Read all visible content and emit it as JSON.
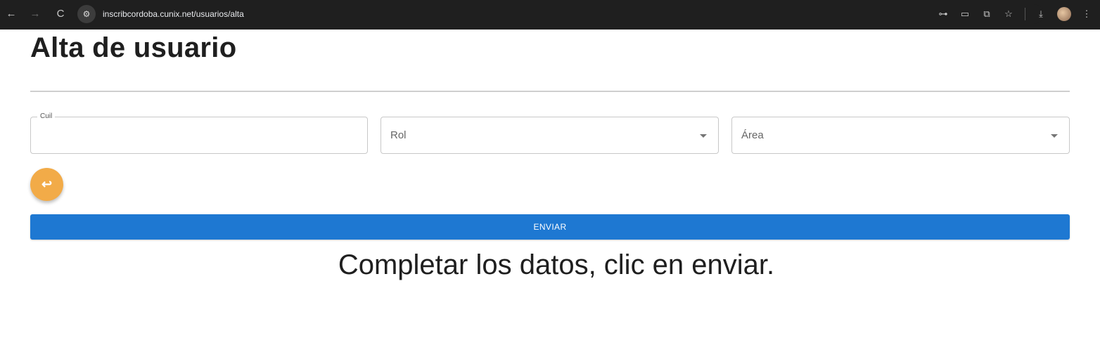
{
  "browser": {
    "nav": {
      "back_icon": "←",
      "forward_icon": "→",
      "reload_icon": "C"
    },
    "site_info_icon": "⚙",
    "url": "inscribcordoba.cunix.net/usuarios/alta",
    "toolbar": {
      "key_icon": "⊶",
      "cast_icon": "▭",
      "translate_icon": "⧉",
      "star_icon": "☆",
      "download_icon": "⤓",
      "menu_icon": "⋮"
    }
  },
  "page": {
    "title": "Alta de usuario",
    "form": {
      "cuil": {
        "label": "Cuil",
        "value": ""
      },
      "rol": {
        "value": "Rol"
      },
      "area": {
        "value": "Área"
      }
    },
    "back_button_icon": "↩",
    "submit_label": "ENVIAR",
    "caption": "Completar los datos, clic en enviar."
  },
  "colors": {
    "accent_primary": "#1e78d2",
    "accent_back": "#f2ab48"
  }
}
